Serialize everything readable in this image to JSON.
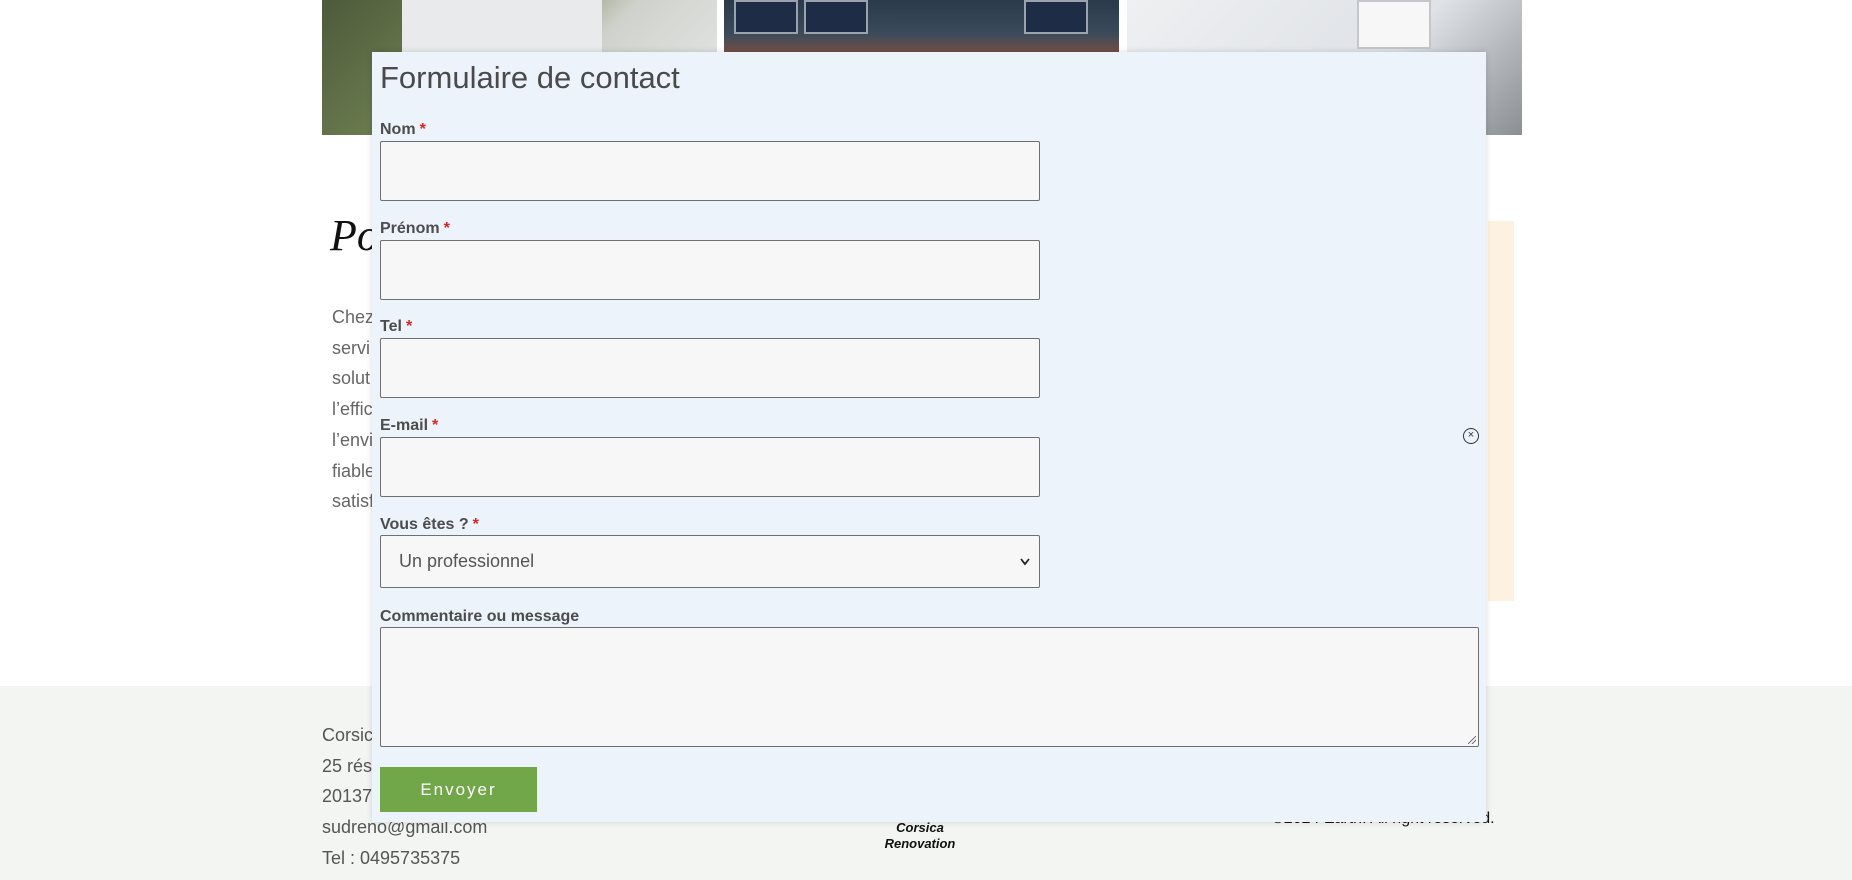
{
  "background": {
    "section_title": "Po",
    "section_text_lines": [
      "Chez",
      "servi",
      "solut",
      "l’effic",
      "l’envi",
      "fiable",
      "satisf"
    ],
    "footer": {
      "lines": [
        "Corsic",
        "25 rés",
        "20137",
        "sudreno@gmail.com",
        "Tel : 0495735375"
      ],
      "logo_line1": "Corsica",
      "logo_line2": "Renovation",
      "copyright": "©2024 Earth. All right reserved."
    }
  },
  "modal": {
    "title": "Formulaire de contact",
    "required_mark": "*",
    "fields": {
      "nom": {
        "label": "Nom",
        "value": ""
      },
      "prenom": {
        "label": "Prénom",
        "value": ""
      },
      "tel": {
        "label": "Tel",
        "value": ""
      },
      "email": {
        "label": "E-mail",
        "value": ""
      },
      "type": {
        "label": "Vous êtes ?",
        "selected": "Un professionnel"
      },
      "message": {
        "label": "Commentaire ou message",
        "value": ""
      }
    },
    "submit_label": "Envoyer",
    "close_glyph": "×"
  },
  "colors": {
    "modal_bg": "#ecf3fb",
    "required": "#e2211c",
    "submit_bg": "#71a649",
    "footer_bg": "#f3f5f2",
    "beige_box": "#fdf2df"
  }
}
